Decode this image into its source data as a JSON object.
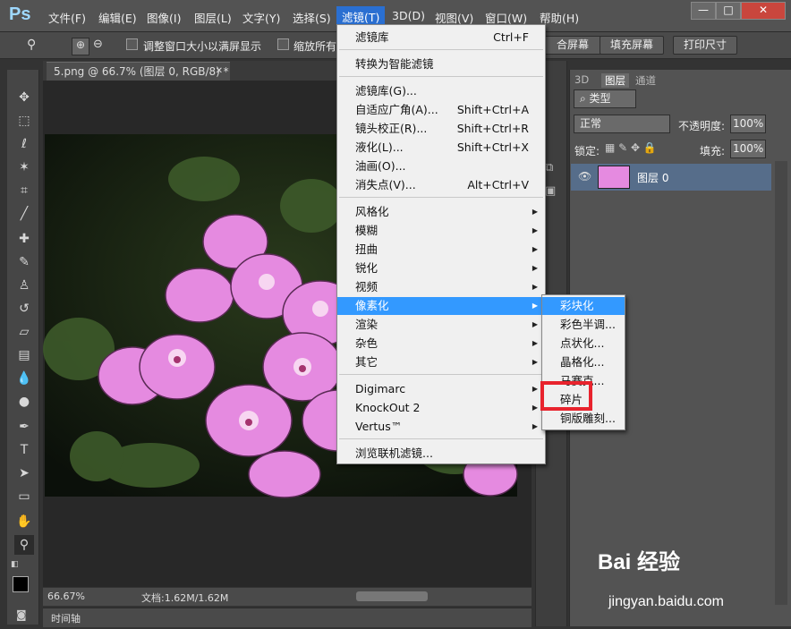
{
  "app": {
    "logo": "Ps"
  },
  "menubar": {
    "items": [
      "文件(F)",
      "编辑(E)",
      "图像(I)",
      "图层(L)",
      "文字(Y)",
      "选择(S)",
      "滤镜(T)",
      "3D(D)",
      "视图(V)",
      "窗口(W)",
      "帮助(H)"
    ],
    "active": "滤镜(T)",
    "window_buttons": [
      "—",
      "□",
      "✕"
    ]
  },
  "options": {
    "resize_window_label": "调整窗口大小以满屏显示",
    "zoom_all_label": "缩放所有",
    "fill_screen_btn": "填充屏幕",
    "print_size_btn": "打印尺寸",
    "fit_screen_btn": "合屏幕"
  },
  "document": {
    "tab_title": "5.png @ 66.7% (图层 0, RGB/8) *",
    "close_icon": "✕",
    "zoom_display": "66.67%",
    "doc_info": "文档:1.62M/1.62M",
    "timeline_label": "时间轴"
  },
  "filter_menu": {
    "items": [
      {
        "label": "滤镜库",
        "shortcut": "Ctrl+F",
        "arrow": false
      },
      {
        "label": "转换为智能滤镜",
        "shortcut": "",
        "arrow": false
      },
      {
        "label": "滤镜库(G)...",
        "shortcut": "",
        "arrow": false
      },
      {
        "label": "自适应广角(A)...",
        "shortcut": "Shift+Ctrl+A",
        "arrow": false
      },
      {
        "label": "镜头校正(R)...",
        "shortcut": "Shift+Ctrl+R",
        "arrow": false
      },
      {
        "label": "液化(L)...",
        "shortcut": "Shift+Ctrl+X",
        "arrow": false
      },
      {
        "label": "油画(O)...",
        "shortcut": "",
        "arrow": false
      },
      {
        "label": "消失点(V)...",
        "shortcut": "Alt+Ctrl+V",
        "arrow": false
      },
      {
        "label": "风格化",
        "shortcut": "",
        "arrow": true
      },
      {
        "label": "模糊",
        "shortcut": "",
        "arrow": true
      },
      {
        "label": "扭曲",
        "shortcut": "",
        "arrow": true
      },
      {
        "label": "锐化",
        "shortcut": "",
        "arrow": true
      },
      {
        "label": "视频",
        "shortcut": "",
        "arrow": true
      },
      {
        "label": "像素化",
        "shortcut": "",
        "arrow": true
      },
      {
        "label": "渲染",
        "shortcut": "",
        "arrow": true
      },
      {
        "label": "杂色",
        "shortcut": "",
        "arrow": true
      },
      {
        "label": "其它",
        "shortcut": "",
        "arrow": true
      },
      {
        "label": "Digimarc",
        "shortcut": "",
        "arrow": true
      },
      {
        "label": "KnockOut 2",
        "shortcut": "",
        "arrow": true
      },
      {
        "label": "Vertus™",
        "shortcut": "",
        "arrow": true
      },
      {
        "label": "浏览联机滤镜...",
        "shortcut": "",
        "arrow": false
      }
    ],
    "highlighted": "像素化"
  },
  "pixelate_submenu": {
    "items": [
      "彩块化",
      "彩色半调...",
      "点状化...",
      "晶格化...",
      "马赛克...",
      "碎片",
      "铜版雕刻..."
    ],
    "highlighted": "彩块化",
    "marked": "碎片"
  },
  "layers_panel": {
    "tabs": [
      "3D",
      "图层",
      "通道"
    ],
    "active_tab": "图层",
    "filter_type": "类型",
    "blend_mode": "正常",
    "opacity_label": "不透明度:",
    "opacity_value": "100%",
    "lock_label": "锁定:",
    "fill_label": "填充:",
    "fill_value": "100%",
    "layer_name": "图层 0"
  },
  "watermark": {
    "brand": "Bai 经验",
    "url": "jingyan.baidu.com"
  },
  "colors": {
    "menu_highlight": "#3399ff",
    "marker": "#e8232d",
    "flower": "#e58ae0"
  }
}
